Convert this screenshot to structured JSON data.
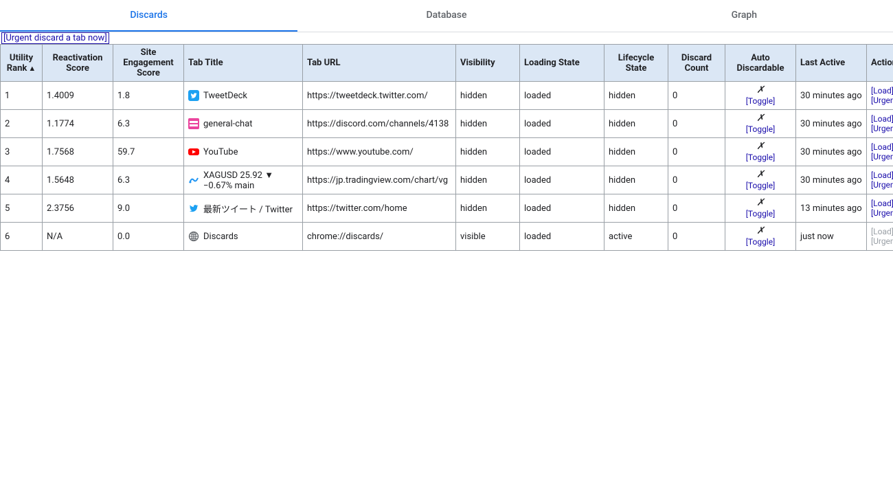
{
  "tabs": {
    "items": [
      {
        "label": "Discards",
        "active": true
      },
      {
        "label": "Database",
        "active": false
      },
      {
        "label": "Graph",
        "active": false
      }
    ]
  },
  "urgent_link": "[Urgent discard a tab now]",
  "columns": {
    "utility_rank": "Utility Rank",
    "reactivation_score": "Reactivation Score",
    "site_engagement_score": "Site Engagement Score",
    "tab_title": "Tab Title",
    "tab_url": "Tab URL",
    "visibility": "Visibility",
    "loading_state": "Loading State",
    "lifecycle_state": "Lifecycle State",
    "discard_count": "Discard Count",
    "auto_discardable": "Auto Discardable",
    "last_active": "Last Active",
    "actions": "Actions"
  },
  "sort": {
    "column": "utility_rank",
    "direction": "asc",
    "arrow": "▲"
  },
  "labels": {
    "toggle": "[Toggle]",
    "load": "[Load]",
    "urgent_discard": "[Urgent Discard]",
    "x": "✗"
  },
  "rows": [
    {
      "rank": "1",
      "reactivation": "1.4009",
      "engagement": "1.8",
      "icon": "tweetdeck",
      "title": "TweetDeck",
      "url": "https://tweetdeck.twitter.com/",
      "visibility": "hidden",
      "loading": "loaded",
      "lifecycle": "hidden",
      "discard_count": "0",
      "auto_x": true,
      "last_active": "30 minutes ago",
      "actions_enabled": true
    },
    {
      "rank": "2",
      "reactivation": "1.1774",
      "engagement": "6.3",
      "icon": "discord",
      "title": "general-chat",
      "url": "https://discord.com/channels/4138",
      "visibility": "hidden",
      "loading": "loaded",
      "lifecycle": "hidden",
      "discard_count": "0",
      "auto_x": true,
      "last_active": "30 minutes ago",
      "actions_enabled": true
    },
    {
      "rank": "3",
      "reactivation": "1.7568",
      "engagement": "59.7",
      "icon": "youtube",
      "title": "YouTube",
      "url": "https://www.youtube.com/",
      "visibility": "hidden",
      "loading": "loaded",
      "lifecycle": "hidden",
      "discard_count": "0",
      "auto_x": true,
      "last_active": "30 minutes ago",
      "actions_enabled": true
    },
    {
      "rank": "4",
      "reactivation": "1.5648",
      "engagement": "6.3",
      "icon": "tradingview",
      "title": "XAGUSD 25.92 ▼ −0.67% main",
      "url": "https://jp.tradingview.com/chart/vg",
      "visibility": "hidden",
      "loading": "loaded",
      "lifecycle": "hidden",
      "discard_count": "0",
      "auto_x": true,
      "last_active": "30 minutes ago",
      "actions_enabled": true
    },
    {
      "rank": "5",
      "reactivation": "2.3756",
      "engagement": "9.0",
      "icon": "twitter",
      "title": "最新ツイート / Twitter",
      "url": "https://twitter.com/home",
      "visibility": "hidden",
      "loading": "loaded",
      "lifecycle": "hidden",
      "discard_count": "0",
      "auto_x": true,
      "last_active": "13 minutes ago",
      "actions_enabled": true
    },
    {
      "rank": "6",
      "reactivation": "N/A",
      "engagement": "0.0",
      "icon": "globe",
      "title": "Discards",
      "url": "chrome://discards/",
      "visibility": "visible",
      "loading": "loaded",
      "lifecycle": "active",
      "discard_count": "0",
      "auto_x": true,
      "last_active": "just now",
      "actions_enabled": false
    }
  ]
}
